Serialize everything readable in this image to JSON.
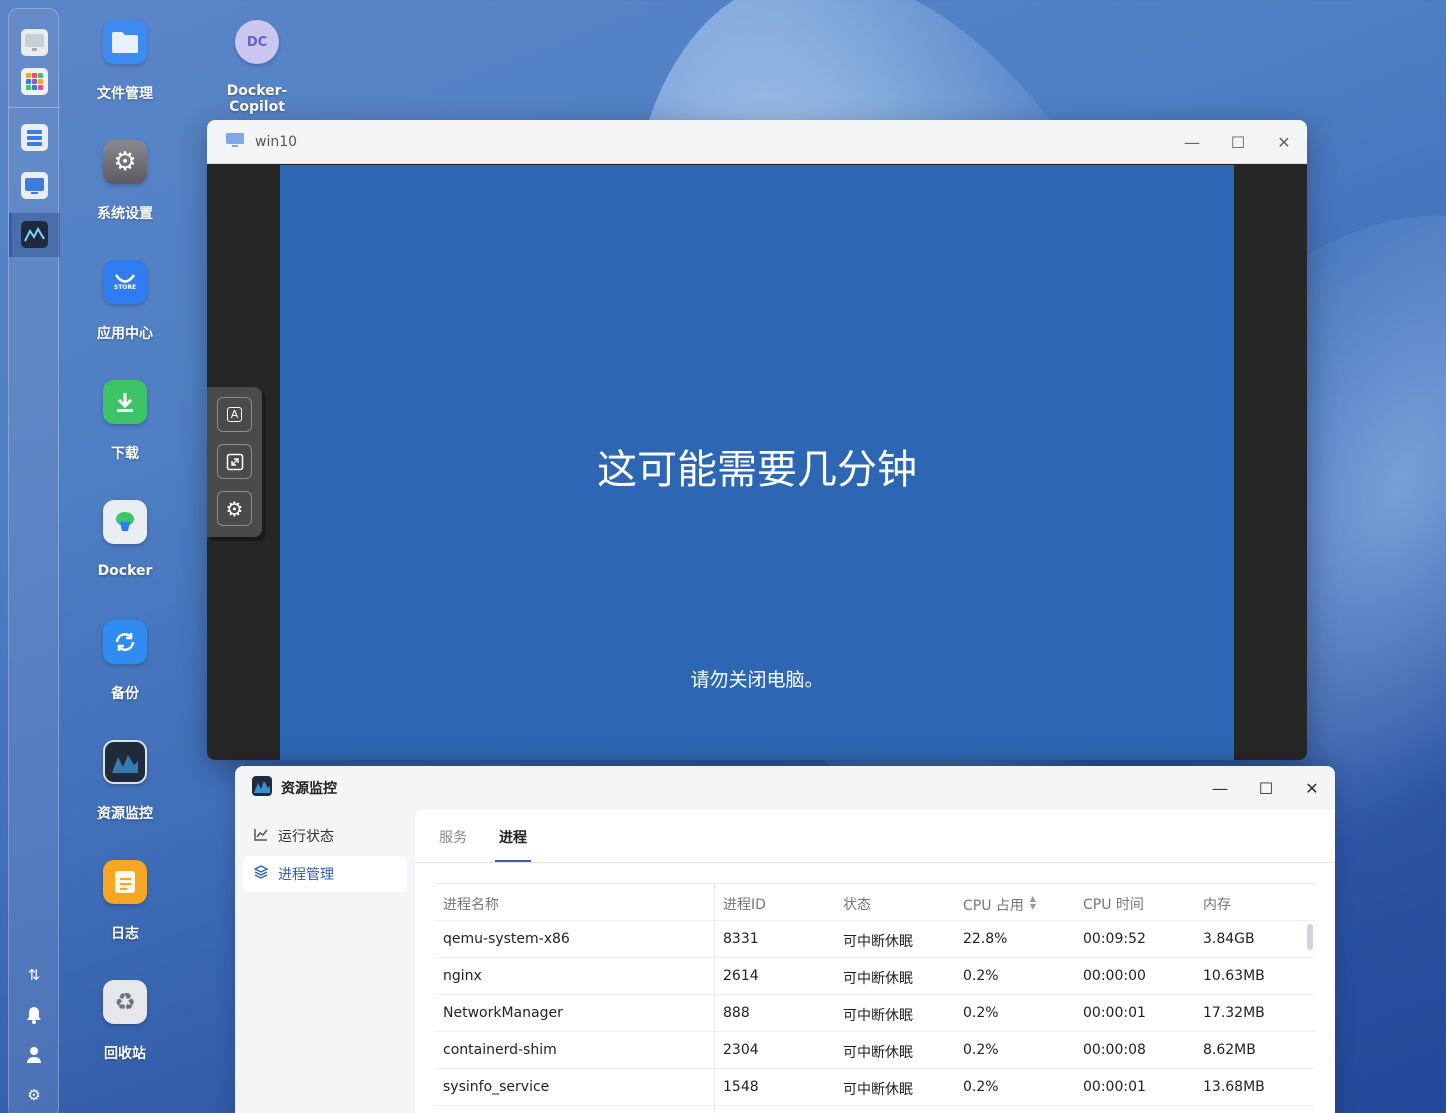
{
  "desktop": {
    "icons": [
      {
        "label": "文件管理",
        "icon": "folder-icon",
        "color": "#3d8bf2"
      },
      {
        "label": "Docker-Copilot",
        "icon": "docker-copilot-icon",
        "color": "#c9c6ef"
      },
      {
        "label": "系统设置",
        "icon": "settings-icon",
        "color": "#6e6e73"
      },
      {
        "label": "应用中心",
        "icon": "store-icon",
        "color": "#2f7cf0"
      },
      {
        "label": "下载",
        "icon": "download-icon",
        "color": "#3dc466"
      },
      {
        "label": "Docker",
        "icon": "docker-icon",
        "color": "#e9eef5"
      },
      {
        "label": "备份",
        "icon": "backup-icon",
        "color": "#2f8cf0"
      },
      {
        "label": "资源监控",
        "icon": "resource-monitor-icon",
        "color": "#1f2a3a"
      },
      {
        "label": "日志",
        "icon": "log-icon",
        "color": "#f5a623"
      },
      {
        "label": "回收站",
        "icon": "trash-icon",
        "color": "#e5e7eb"
      }
    ],
    "dc_badge": "DC",
    "store_badge": "STORE"
  },
  "vm_window": {
    "title": "win10",
    "main_text": "这可能需要几分钟",
    "sub_text": "请勿关闭电脑。",
    "tool_a": "A"
  },
  "monitor": {
    "title": "资源监控",
    "sidebar": [
      {
        "label": "运行状态",
        "icon": "chart-icon"
      },
      {
        "label": "进程管理",
        "icon": "layers-icon"
      }
    ],
    "tabs": [
      "服务",
      "进程"
    ],
    "columns": [
      "进程名称",
      "进程ID",
      "状态",
      "CPU 占用",
      "CPU 时间",
      "内存"
    ],
    "sort_indicator": "▲▼",
    "rows": [
      [
        "qemu-system-x86",
        "8331",
        "可中断休眠",
        "22.8%",
        "00:09:52",
        "3.84GB"
      ],
      [
        "nginx",
        "2614",
        "可中断休眠",
        "0.2%",
        "00:00:00",
        "10.63MB"
      ],
      [
        "NetworkManager",
        "888",
        "可中断休眠",
        "0.2%",
        "00:00:01",
        "17.32MB"
      ],
      [
        "containerd-shim",
        "2304",
        "可中断休眠",
        "0.2%",
        "00:00:08",
        "8.62MB"
      ],
      [
        "sysinfo_service",
        "1548",
        "可中断休眠",
        "0.2%",
        "00:00:01",
        "13.68MB"
      ]
    ]
  },
  "accent_color": "#2f5fb6"
}
